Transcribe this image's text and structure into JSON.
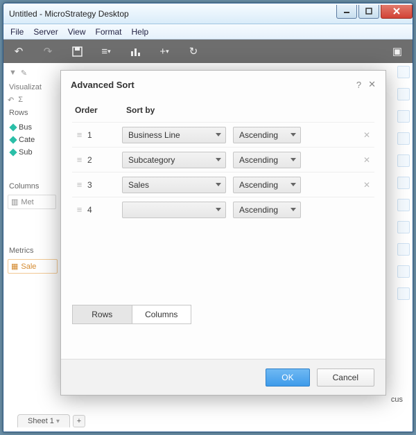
{
  "window": {
    "title": "Untitled - MicroStrategy Desktop"
  },
  "menu": {
    "file": "File",
    "server": "Server",
    "view": "View",
    "format": "Format",
    "help": "Help"
  },
  "leftpanel": {
    "title": "Visualizat",
    "rows_label": "Rows",
    "rows": [
      {
        "label": "Bus"
      },
      {
        "label": "Cate"
      },
      {
        "label": "Sub"
      }
    ],
    "columns_label": "Columns",
    "columns_chip": "Met",
    "metrics_label": "Metrics",
    "metrics_chip": "Sale"
  },
  "dialog": {
    "title": "Advanced Sort",
    "headers": {
      "order": "Order",
      "sortby": "Sort by"
    },
    "rows": [
      {
        "order": "1",
        "sortby": "Business Line",
        "dir": "Ascending",
        "removable": true
      },
      {
        "order": "2",
        "sortby": "Subcategory",
        "dir": "Ascending",
        "removable": true
      },
      {
        "order": "3",
        "sortby": "Sales",
        "dir": "Ascending",
        "removable": true
      },
      {
        "order": "4",
        "sortby": "",
        "dir": "Ascending",
        "removable": false
      }
    ],
    "toggle": {
      "rows": "Rows",
      "columns": "Columns",
      "active": "rows"
    },
    "ok": "OK",
    "cancel": "Cancel"
  },
  "sheet": {
    "name": "Sheet 1"
  },
  "misc": {
    "cus": "cus"
  }
}
